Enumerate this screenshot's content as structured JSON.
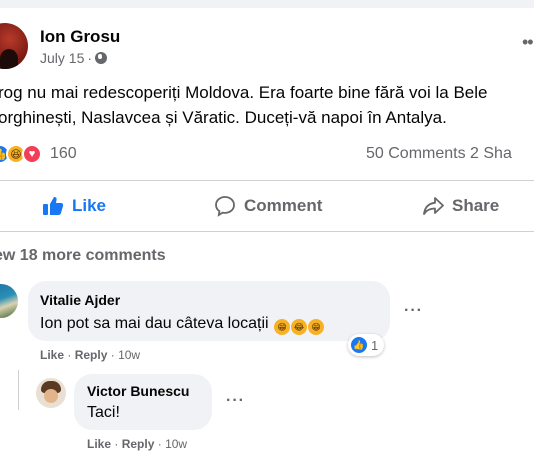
{
  "post": {
    "author": "Ion Grosu",
    "date": "July 15",
    "date_separator": "·",
    "more_label": "...",
    "text_line1": "rog nu mai redescoperiți Moldova. Era foarte bine fără voi la Bele",
    "text_line2": "orghinești, Naslavcea și Văratic. Duceți-vă napoi în Antalya.",
    "reaction_count": "160",
    "comment_share_summary": "50 Comments  2 Sha",
    "privacy_icon": "globe-icon"
  },
  "actions": {
    "like": "Like",
    "comment": "Comment",
    "share": "Share"
  },
  "comments_header": {
    "view_more": "ew 18 more comments"
  },
  "comments": [
    {
      "author": "Vitalie Ajder",
      "text": "Ion pot sa mai dau câteva locații",
      "reaction_count": "1",
      "like_label": "Like",
      "reply_label": "Reply",
      "time": "10w",
      "more_label": "···"
    },
    {
      "author": "Victor Bunescu",
      "text": "Taci!",
      "like_label": "Like",
      "reply_label": "Reply",
      "time": "10w",
      "more_label": "···"
    }
  ],
  "colors": {
    "accent": "#1877f2",
    "secondary_text": "#65676b",
    "bubble": "#f0f2f5"
  }
}
